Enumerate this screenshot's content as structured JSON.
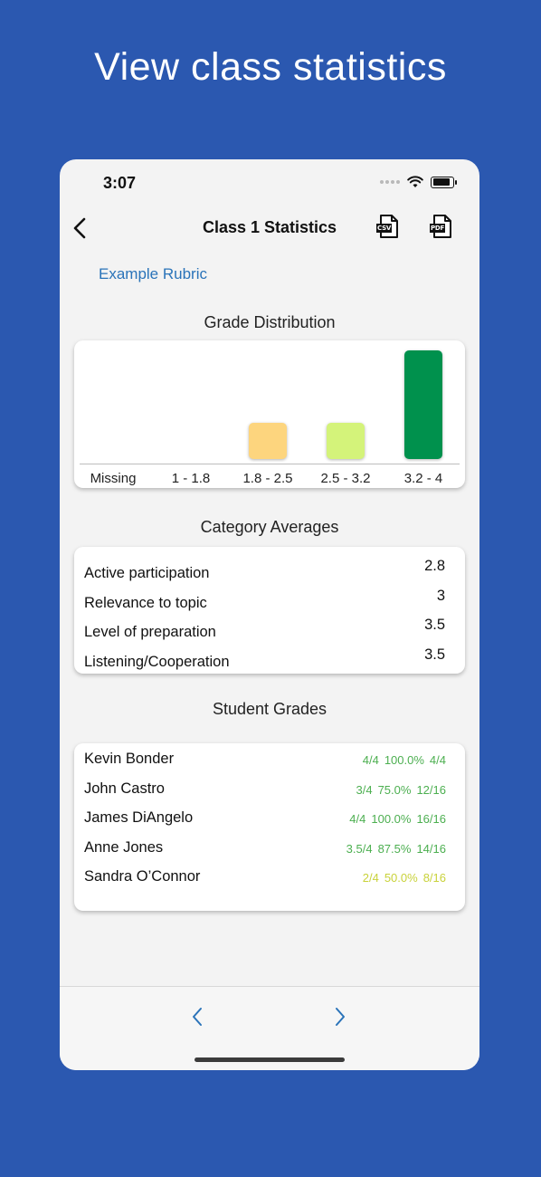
{
  "headline": "View class statistics",
  "status_bar": {
    "time": "3:07"
  },
  "navbar": {
    "title": "Class 1 Statistics",
    "csv_label": "CSV",
    "pdf_label": "PDF"
  },
  "rubric_link": "Example Rubric",
  "grade_distribution": {
    "title": "Grade Distribution"
  },
  "chart_data": {
    "type": "bar",
    "categories": [
      "Missing",
      "1 - 1.8",
      "1.8 - 2.5",
      "2.5 - 3.2",
      "3.2 - 4"
    ],
    "values": [
      0,
      0,
      1,
      1,
      3
    ],
    "colors": [
      "#cccccc",
      "#f28b82",
      "#fdd57e",
      "#d4f37a",
      "#00914d"
    ],
    "ylim": [
      0,
      3
    ]
  },
  "category_averages": {
    "title": "Category Averages",
    "rows": [
      {
        "name": "Active participation",
        "value": "2.8"
      },
      {
        "name": "Relevance to topic",
        "value": "3"
      },
      {
        "name": "Level of preparation",
        "value": "3.5"
      },
      {
        "name": "Listening/Cooperation",
        "value": "3.5"
      }
    ]
  },
  "student_grades": {
    "title": "Student Grades",
    "rows": [
      {
        "name": "Kevin Bonder",
        "score": "4/4",
        "percent": "100.0%",
        "points": "4/4",
        "color": "green"
      },
      {
        "name": "John Castro",
        "score": "3/4",
        "percent": "75.0%",
        "points": "12/16",
        "color": "green"
      },
      {
        "name": "James DiAngelo",
        "score": "4/4",
        "percent": "100.0%",
        "points": "16/16",
        "color": "green"
      },
      {
        "name": "Anne Jones",
        "score": "3.5/4",
        "percent": "87.5%",
        "points": "14/16",
        "color": "green"
      },
      {
        "name": "Sandra O’Connor",
        "score": "2/4",
        "percent": "50.0%",
        "points": "8/16",
        "color": "yellow"
      }
    ]
  },
  "colors": {
    "background": "#2b58b0",
    "link": "#2a73b9",
    "accent": "#00914d"
  },
  "icons": {
    "back": "chevron-left-icon",
    "prev": "chevron-left-icon",
    "next": "chevron-right-icon"
  }
}
